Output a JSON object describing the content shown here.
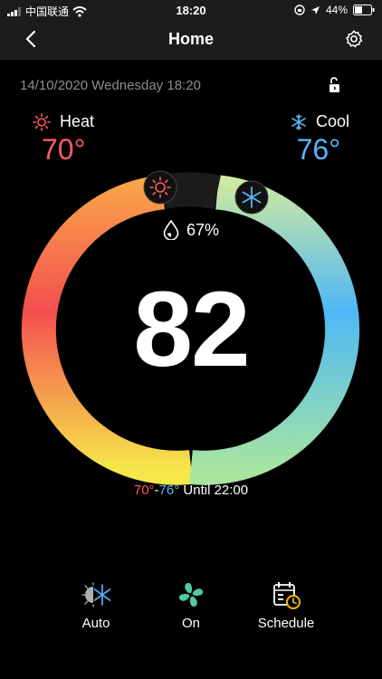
{
  "status_bar": {
    "carrier": "中国联通",
    "time": "18:20",
    "battery": "44%"
  },
  "header": {
    "title": "Home"
  },
  "info": {
    "datetime": "14/10/2020 Wednesday 18:20"
  },
  "heat": {
    "label": "Heat",
    "setpoint": "70°"
  },
  "cool": {
    "label": "Cool",
    "setpoint": "76°"
  },
  "humidity": {
    "value": "67%"
  },
  "current_temperature": "82",
  "range": {
    "low": "70°",
    "separator": "-",
    "high": "76°",
    "until": "Until 22:00"
  },
  "actions": [
    {
      "label": "Auto",
      "icon": "auto-mode-icon"
    },
    {
      "label": "On",
      "icon": "fan-icon"
    },
    {
      "label": "Schedule",
      "icon": "schedule-icon"
    }
  ],
  "colors": {
    "heat": "#ff5a5f",
    "cool": "#5ab5f6",
    "background": "#000000",
    "bar": "#1c1c1e",
    "schedule_accent": "#f5b800"
  }
}
